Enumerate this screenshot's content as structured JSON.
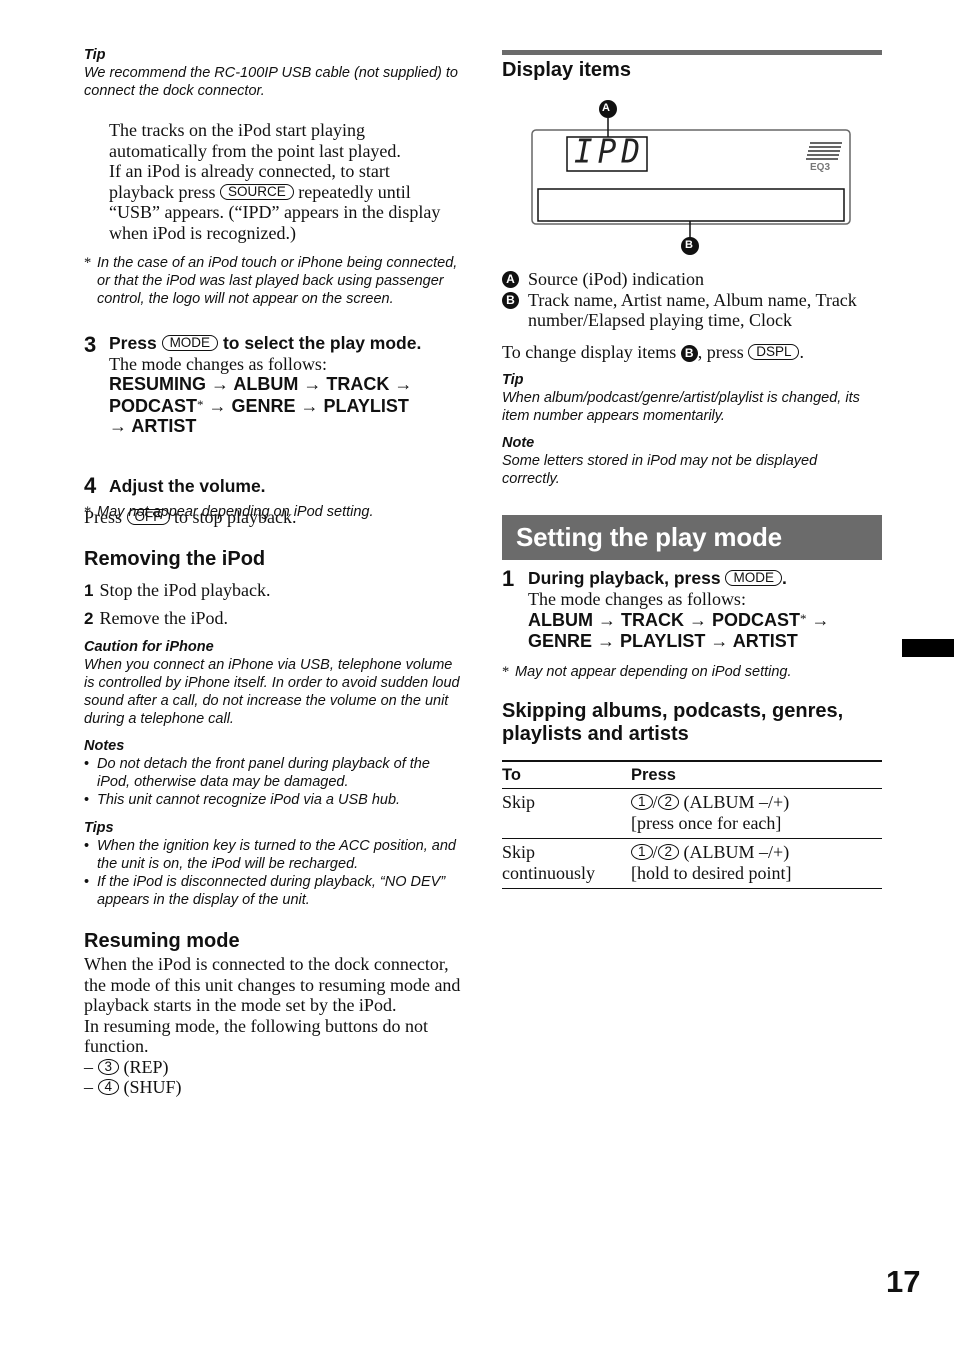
{
  "page_number": "17",
  "left": {
    "tip1": {
      "label": "Tip",
      "text": "We recommend the RC-100IP USB cable (not supplied) to connect the dock connector."
    },
    "playing_para": {
      "line1": "The tracks on the iPod start playing",
      "line2": "automatically from the point last played.",
      "line3": "If an iPod is already connected, to start",
      "line4_pre": "playback press",
      "source_key": "SOURCE",
      "line4_post": "repeatedly until",
      "line5": "“USB” appears. (“IPD” appears in the display",
      "line6": "when iPod is recognized.)"
    },
    "footnote1": {
      "star": "*",
      "text": "In the case of an iPod touch or iPhone being connected, or that the iPod was last played back using passenger control, the logo will not appear on the screen."
    },
    "step3": {
      "number": "3",
      "pre": "Press",
      "key": "MODE",
      "post": "to select the play mode.",
      "desc": "The mode changes as follows:",
      "modes_line1": "RESUMING → ALBUM → TRACK →",
      "modes_line2_a": "PODCAST",
      "modes_line2_star": "*",
      "modes_line2_b": " → GENRE → PLAYLIST",
      "modes_line3": "→ ARTIST"
    },
    "footnote2": {
      "star": "*",
      "text": "May not appear depending on iPod setting."
    },
    "step4": {
      "number": "4",
      "title": "Adjust the volume.",
      "pre": "Press",
      "key": "OFF",
      "post": "to stop playback."
    },
    "removing": {
      "heading": "Removing the iPod",
      "steps": [
        {
          "number": "1",
          "text": "Stop the iPod playback."
        },
        {
          "number": "2",
          "text": "Remove the iPod."
        }
      ]
    },
    "caution": {
      "label": "Caution for iPhone",
      "text": "When you connect an iPhone via USB, telephone volume is controlled by iPhone itself. In order to avoid sudden loud sound after a call, do not increase the volume on the unit during a telephone call."
    },
    "notes": {
      "label": "Notes",
      "items": [
        "Do not detach the front panel during playback of the iPod, otherwise data may be damaged.",
        "This unit cannot recognize iPod via a USB hub."
      ]
    },
    "tips": {
      "label": "Tips",
      "items": [
        "When the ignition key is turned to the ACC position, and the unit is on, the iPod will be recharged.",
        "If the iPod is disconnected during playback, “NO DEV” appears in the display of the unit."
      ]
    },
    "resuming": {
      "heading": "Resuming mode",
      "text1": "When the iPod is connected to the dock connector, the mode of this unit changes to resuming mode and playback starts in the mode set by the iPod.",
      "text2": "In resuming mode, the following buttons do not function.",
      "buttons": [
        {
          "dash": "–",
          "key": "3",
          "label": "(REP)"
        },
        {
          "dash": "–",
          "key": "4",
          "label": "(SHUF)"
        }
      ]
    }
  },
  "right": {
    "display_items": {
      "heading": "Display items",
      "diagram": {
        "callout_a": "A",
        "callout_b": "B",
        "lcd_text": "IPD",
        "eq_label": "EQ3"
      },
      "legend": [
        {
          "marker": "A",
          "text": "Source (iPod) indication"
        },
        {
          "marker": "B",
          "text": "Track name, Artist name, Album name, Track number/Elapsed playing time, Clock"
        }
      ],
      "change_pre": "To change display items",
      "change_marker": "B",
      "change_mid": ", press",
      "change_key": "DSPL",
      "change_post": "."
    },
    "tip": {
      "label": "Tip",
      "text": "When album/podcast/genre/artist/playlist is changed, its item number appears momentarily."
    },
    "note": {
      "label": "Note",
      "text": "Some letters stored in iPod may not be displayed correctly."
    },
    "play_mode": {
      "banner": "Setting the play mode",
      "step1": {
        "number": "1",
        "pre": "During playback, press",
        "key": "MODE",
        "post": ".",
        "desc": "The mode changes as follows:",
        "modes_line1_a": "ALBUM → TRACK → PODCAST",
        "modes_line1_star": "*",
        "modes_line1_b": " →",
        "modes_line2": "GENRE → PLAYLIST → ARTIST"
      },
      "footnote": {
        "star": "*",
        "text": "May not appear depending on iPod setting."
      }
    },
    "skipping": {
      "heading": "Skipping albums, podcasts, genres, playlists and artists",
      "columns": [
        "To",
        "Press"
      ],
      "rows": [
        {
          "to": "Skip",
          "key1": "1",
          "key2": "2",
          "press": "(ALBUM –/+)",
          "note": "[press once for each]"
        },
        {
          "to": "Skip continuously",
          "key1": "1",
          "key2": "2",
          "press": "(ALBUM –/+)",
          "note": "[hold to desired point]"
        }
      ]
    }
  }
}
